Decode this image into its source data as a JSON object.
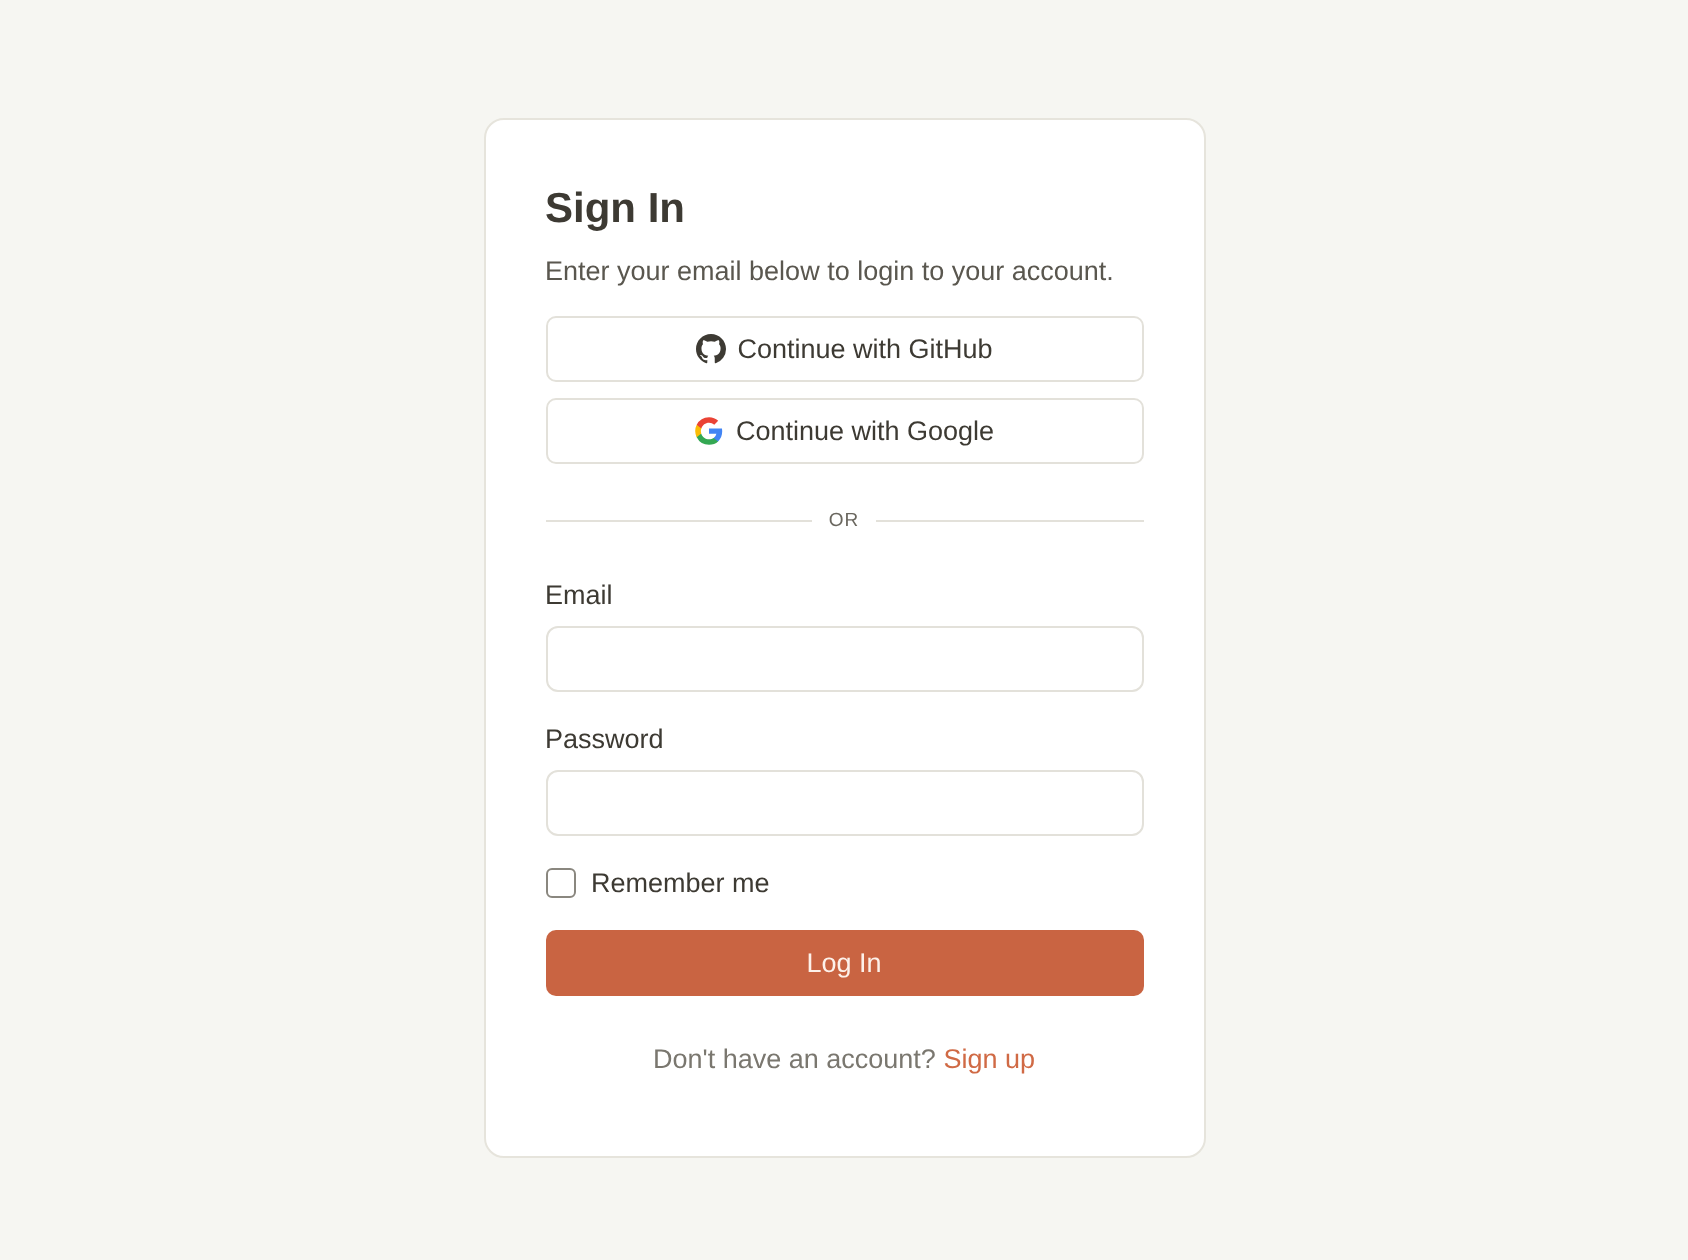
{
  "title": "Sign In",
  "subtitle": "Enter your email below to login to your account.",
  "providers": [
    {
      "kind": "github",
      "label": "Continue with GitHub"
    },
    {
      "kind": "google",
      "label": "Continue with Google"
    }
  ],
  "divider": "OR",
  "fields": [
    {
      "label": "Email"
    },
    {
      "label": "Password"
    }
  ],
  "remember": {
    "label": "Remember me",
    "checked": false
  },
  "submit": "Log In",
  "footer": {
    "text": "Don't have an account?",
    "link": "Sign up"
  }
}
